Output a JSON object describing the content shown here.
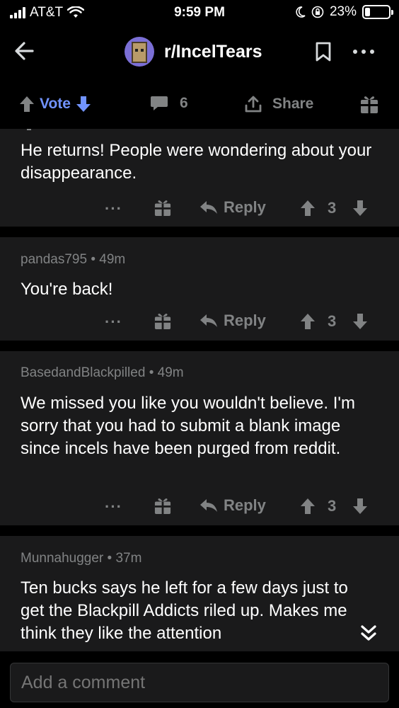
{
  "status_bar": {
    "carrier": "AT&T",
    "time": "9:59 PM",
    "battery": "23%",
    "battery_level": 0.23
  },
  "header": {
    "subreddit": "r/IncelTears",
    "icons": [
      "back-arrow-icon",
      "bookmark-icon",
      "more-icon"
    ]
  },
  "post_actions": {
    "vote_label": "Vote",
    "comment_count": "6",
    "share_label": "Share"
  },
  "comments": [
    {
      "author": "",
      "age": "",
      "text": "He returns! People were wondering about your disappearance.",
      "reply_label": "Reply",
      "score": "3"
    },
    {
      "author": "pandas795",
      "age": "49m",
      "text": "You're back!",
      "reply_label": "Reply",
      "score": "3"
    },
    {
      "author": "BasedandBlackpilled",
      "age": "49m",
      "text": "We missed you like you wouldn't believe.  I'm sorry that you had to submit a blank image since incels have been purged from reddit.",
      "reply_label": "Reply",
      "score": "3"
    },
    {
      "author": "Munnahugger",
      "age": "37m",
      "text": "Ten bucks says he left for a few days just to get the Blackpill Addicts riled up. Makes me think they like the attention",
      "reply_label": "",
      "score": ""
    }
  ],
  "composer": {
    "placeholder": "Add a comment"
  },
  "colors": {
    "background": "#000000",
    "card": "#1a1a1b",
    "accent_vote": "#7193ff",
    "muted": "#818384"
  }
}
